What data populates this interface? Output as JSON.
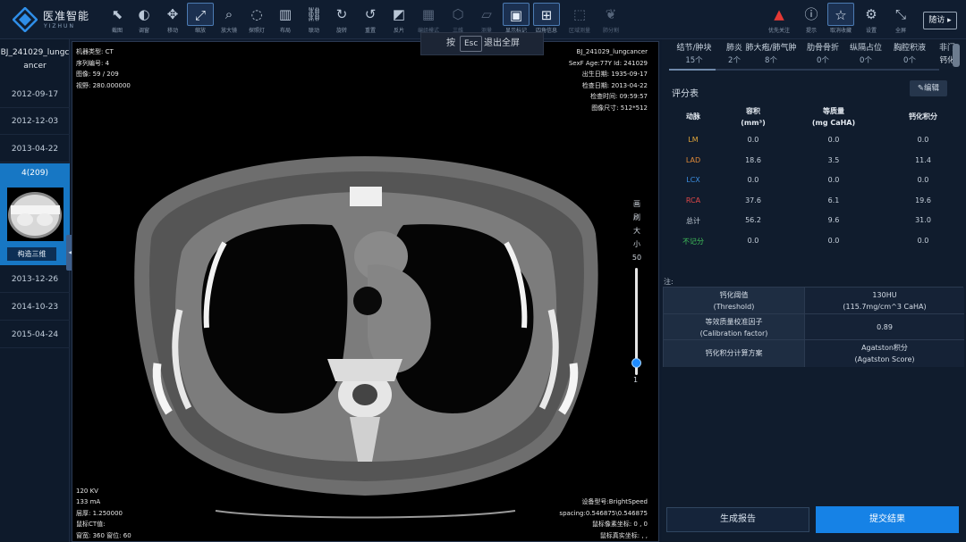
{
  "app": {
    "name": "医准智能",
    "sub": "YIZHUN"
  },
  "toolbar": {
    "tools": [
      {
        "icon": "cursor-icon",
        "label": "截图"
      },
      {
        "icon": "contrast-icon",
        "label": "调窗"
      },
      {
        "icon": "move-icon",
        "label": "移动"
      },
      {
        "icon": "zoom-fit-icon",
        "label": "缩放"
      },
      {
        "icon": "magnifier-icon",
        "label": "放大镜"
      },
      {
        "icon": "spotlight-icon",
        "label": "探照灯"
      },
      {
        "icon": "layout-icon",
        "label": "布局"
      },
      {
        "icon": "link-icon",
        "label": "联动"
      },
      {
        "icon": "rotate-icon",
        "label": "旋转"
      },
      {
        "icon": "reset-icon",
        "label": "重置"
      },
      {
        "icon": "invert-icon",
        "label": "反片"
      },
      {
        "icon": "grid-icon",
        "label": "编组模式"
      },
      {
        "icon": "cube-icon",
        "label": "三维"
      },
      {
        "icon": "ruler-icon",
        "label": "测量"
      },
      {
        "icon": "chip-icon",
        "label": "显示标记"
      },
      {
        "icon": "info-grid-icon",
        "label": "四角信息"
      },
      {
        "icon": "area-icon",
        "label": "区域测量"
      },
      {
        "icon": "lung-icon",
        "label": "肺分割"
      }
    ],
    "right_tools": [
      {
        "icon": "warning-icon",
        "label": "优先关注"
      },
      {
        "icon": "alert-circle-icon",
        "label": "提示"
      },
      {
        "icon": "star-icon",
        "label": "取消收藏"
      },
      {
        "icon": "gear-icon",
        "label": "设置"
      },
      {
        "icon": "fullscreen-icon",
        "label": "全屏"
      }
    ],
    "help_label": "随访",
    "warning_color": "#e53935"
  },
  "esc_tip": {
    "press": "按",
    "key": "Esc",
    "action": "退出全屏"
  },
  "sidebar": {
    "study_id": "BJ_241029_lungcancer",
    "dates_top": [
      "2012-09-17",
      "2012-12-03",
      "2013-04-22"
    ],
    "series": {
      "title": "4(209)",
      "button": "构造三维"
    },
    "dates_bottom": [
      "2013-12-26",
      "2014-10-23",
      "2015-04-24"
    ],
    "collapse_icon": "chevron-left-icon",
    "active_color": "#1777c4"
  },
  "viewer": {
    "tl": [
      "机器类型: CT",
      "序列编号: 4",
      "图像: 59 / 209",
      "视野: 280.000000"
    ],
    "tr": [
      "BJ_241029_lungcancer",
      "SexF Age:77Y Id: 241029",
      "出生日期: 1935-09-17",
      "检查日期: 2013-04-22",
      "检查时间: 09:59:57",
      "图像尺寸: 512*512"
    ],
    "bl": [
      "120 KV",
      "133 mA",
      "层厚: 1.250000",
      "鼠标CT值:",
      "窗宽: 360  窗位: 60"
    ],
    "br": [
      "设备型号:BrightSpeed",
      "spacing:0.546875\\0.546875",
      "鼠标像素坐标:  0 , 0",
      "鼠标真实坐标:  ,  ,"
    ],
    "brush": {
      "chars": [
        "画",
        "刷",
        "大",
        "小"
      ],
      "value": "50",
      "min": "1",
      "level": 0.12
    }
  },
  "right_panel": {
    "tabs": [
      {
        "label": "结节/肿块",
        "count": "15个"
      },
      {
        "label": "肺炎",
        "count": "2个"
      },
      {
        "label": "肺大疱/肺气肿",
        "count": "8个"
      },
      {
        "label": "肋骨骨折",
        "count": "0个"
      },
      {
        "label": "纵隔占位",
        "count": "0个"
      },
      {
        "label": "胸腔积液",
        "count": "0个"
      },
      {
        "label": "非门",
        "count": "钙化"
      }
    ],
    "score_title": "评分表",
    "edit_label": "编辑",
    "edit_icon": "pencil-icon",
    "table": {
      "headers": [
        {
          "l1": "动脉",
          "l2": ""
        },
        {
          "l1": "容积",
          "l2": "(mm³)"
        },
        {
          "l1": "等质量",
          "l2": "(mg CaHA)"
        },
        {
          "l1": "钙化积分",
          "l2": ""
        }
      ],
      "rows": [
        {
          "name": "LM",
          "color": "#e0a43a",
          "cells": [
            "0.0",
            "0.0",
            "0.0"
          ]
        },
        {
          "name": "LAD",
          "color": "#e08a38",
          "cells": [
            "18.6",
            "3.5",
            "11.4"
          ]
        },
        {
          "name": "LCX",
          "color": "#3b8ee0",
          "cells": [
            "0.0",
            "0.0",
            "0.0"
          ]
        },
        {
          "name": "RCA",
          "color": "#e04848",
          "cells": [
            "37.6",
            "6.1",
            "19.6"
          ]
        },
        {
          "name": "总计",
          "color": "#c7d1dc",
          "cells": [
            "56.2",
            "9.6",
            "31.0"
          ]
        },
        {
          "name": "不记分",
          "color": "#3fbf5a",
          "cells": [
            "0.0",
            "0.0",
            "0.0"
          ]
        }
      ]
    },
    "note": "注:",
    "params": [
      {
        "l1": "钙化阈值",
        "l2": "(Threshold)",
        "v1": "130HU",
        "v2": "(115.7mg/cm^3 CaHA)"
      },
      {
        "l1": "等效质量校准因子",
        "l2": "(Calibration factor)",
        "v1": "0.89",
        "v2": ""
      },
      {
        "l1": "钙化积分计算方案",
        "l2": "",
        "v1": "Agatston积分",
        "v2": "(Agatston Score)"
      }
    ],
    "gen_report": "生成报告",
    "submit": "提交结果",
    "submit_color": "#1682e6"
  }
}
